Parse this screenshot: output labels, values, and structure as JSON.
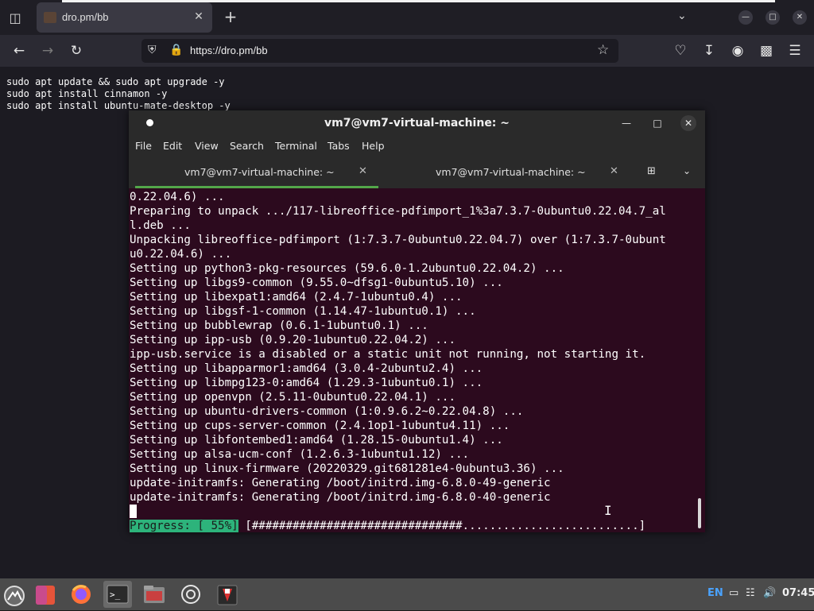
{
  "browser": {
    "tab_title": "dro.pm/bb",
    "url": "https://dro.pm/bb",
    "icons": [
      "tab-list-icon",
      "close-icon",
      "plus-icon",
      "chevron-down-icon",
      "minimize-icon",
      "maximize-icon",
      "close-icon",
      "back-arrow-icon",
      "forward-arrow-icon",
      "reload-icon",
      "shield-icon",
      "lock-icon",
      "star-icon",
      "pocket-icon",
      "download-icon",
      "account-icon",
      "extensions-icon",
      "menu-icon"
    ]
  },
  "page": {
    "commands": [
      "sudo apt update && sudo apt upgrade -y",
      "sudo apt install cinnamon -y",
      "sudo apt install ubuntu-mate-desktop -y"
    ]
  },
  "terminal": {
    "title": "vm7@vm7-virtual-machine: ~",
    "menu": [
      "File",
      "Edit",
      "View",
      "Search",
      "Terminal",
      "Tabs",
      "Help"
    ],
    "tabs": [
      {
        "label": "vm7@vm7-virtual-machine: ~",
        "active": true
      },
      {
        "label": "vm7@vm7-virtual-machine: ~",
        "active": false
      }
    ],
    "lines": [
      "0.22.04.6) ...",
      "Preparing to unpack .../117-libreoffice-pdfimport_1%3a7.3.7-0ubuntu0.22.04.7_al",
      "l.deb ...",
      "Unpacking libreoffice-pdfimport (1:7.3.7-0ubuntu0.22.04.7) over (1:7.3.7-0ubunt",
      "u0.22.04.6) ...",
      "Setting up python3-pkg-resources (59.6.0-1.2ubuntu0.22.04.2) ...",
      "Setting up libgs9-common (9.55.0~dfsg1-0ubuntu5.10) ...",
      "Setting up libexpat1:amd64 (2.4.7-1ubuntu0.4) ...",
      "Setting up libgsf-1-common (1.14.47-1ubuntu0.1) ...",
      "Setting up bubblewrap (0.6.1-1ubuntu0.1) ...",
      "Setting up ipp-usb (0.9.20-1ubuntu0.22.04.2) ...",
      "ipp-usb.service is a disabled or a static unit not running, not starting it.",
      "Setting up libapparmor1:amd64 (3.0.4-2ubuntu2.4) ...",
      "Setting up libmpg123-0:amd64 (1.29.3-1ubuntu0.1) ...",
      "Setting up openvpn (2.5.11-0ubuntu0.22.04.1) ...",
      "Setting up ubuntu-drivers-common (1:0.9.6.2~0.22.04.8) ...",
      "Setting up cups-server-common (2.4.1op1-1ubuntu4.11) ...",
      "Setting up libfontembed1:amd64 (1.28.15-0ubuntu1.4) ...",
      "Setting up alsa-ucm-conf (1.2.6.3-1ubuntu1.12) ...",
      "Setting up linux-firmware (20220329.git681281e4-0ubuntu3.36) ...",
      "update-initramfs: Generating /boot/initrd.img-6.8.0-49-generic",
      "update-initramfs: Generating /boot/initrd.img-6.8.0-40-generic"
    ],
    "progress_label": "Progress: [ 55%]",
    "progress_bar": " [###############################..........................]",
    "progress_fraction": 0.55
  },
  "taskbar": {
    "apps": [
      "menu-icon",
      "mate-icon",
      "firefox-icon",
      "terminal-icon",
      "files-icon",
      "settings-icon",
      "editor-icon"
    ],
    "lang": "EN",
    "clock": "07:45"
  },
  "colors": {
    "terminal_bg": "#2c0a1e",
    "progress_green": "#2db37b",
    "tab_underline": "#53a74a"
  }
}
